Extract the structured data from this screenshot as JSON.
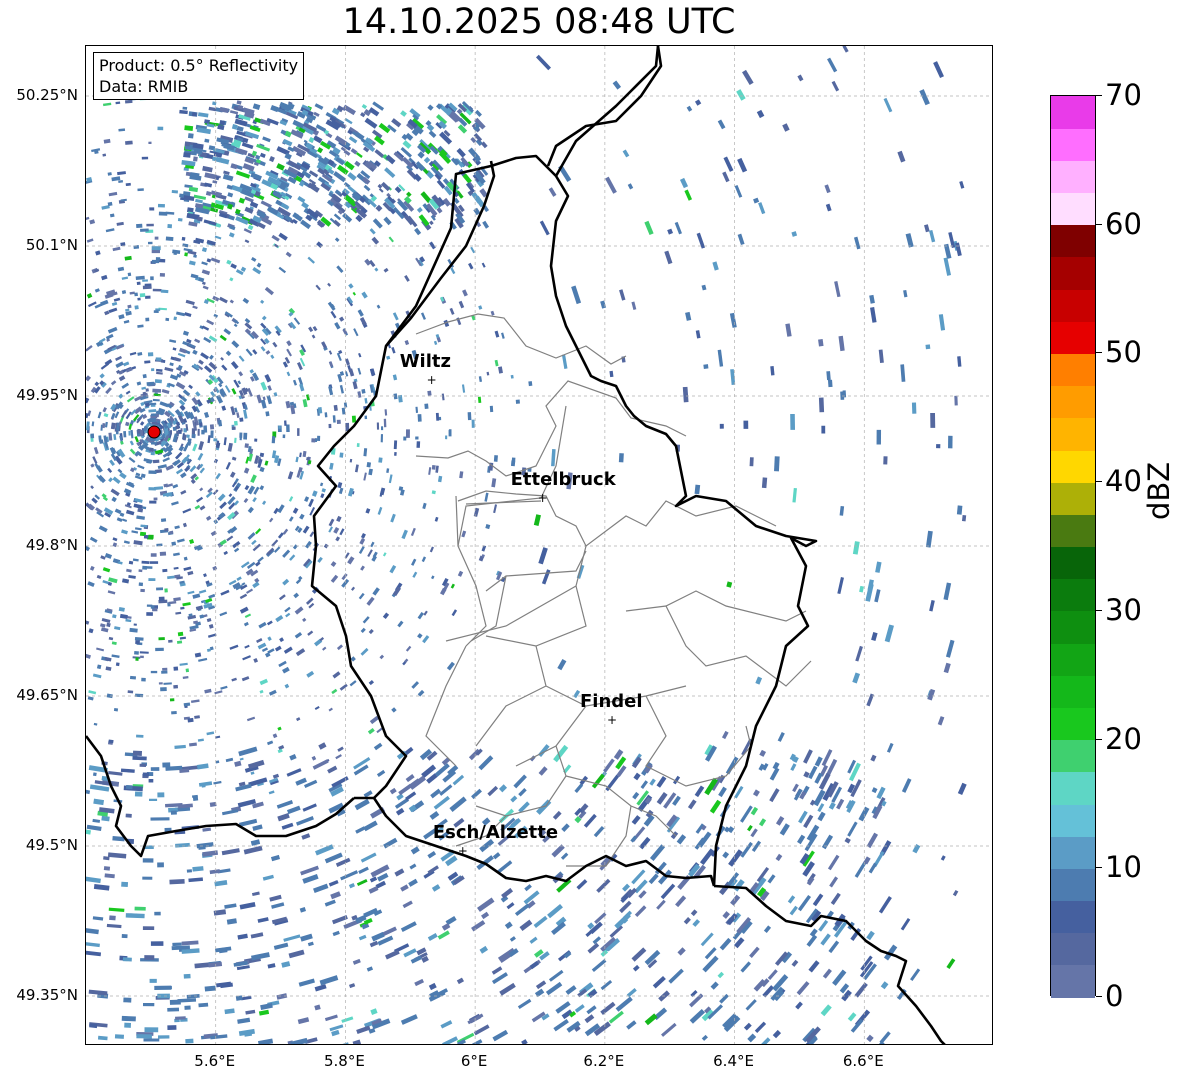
{
  "title": "14.10.2025 08:48 UTC",
  "info": {
    "product": "Product: 0.5° Reflectivity",
    "data": "Data: RMIB"
  },
  "map": {
    "extent": {
      "lon_min": 5.4,
      "lon_max": 6.8,
      "lat_min": 49.3,
      "lat_max": 50.3
    },
    "lat_ticks": [
      {
        "value": 50.25,
        "label": "50.25°N"
      },
      {
        "value": 50.1,
        "label": "50.1°N"
      },
      {
        "value": 49.95,
        "label": "49.95°N"
      },
      {
        "value": 49.8,
        "label": "49.8°N"
      },
      {
        "value": 49.65,
        "label": "49.65°N"
      },
      {
        "value": 49.5,
        "label": "49.5°N"
      },
      {
        "value": 49.35,
        "label": "49.35°N"
      }
    ],
    "lon_ticks": [
      {
        "value": 5.6,
        "label": "5.6°E"
      },
      {
        "value": 5.8,
        "label": "5.8°E"
      },
      {
        "value": 6.0,
        "label": "6°E"
      },
      {
        "value": 6.2,
        "label": "6.2°E"
      },
      {
        "value": 6.4,
        "label": "6.4°E"
      },
      {
        "value": 6.6,
        "label": "6.6°E"
      }
    ],
    "gridlines": true,
    "radar_site": {
      "lon": 5.505,
      "lat": 49.914
    },
    "cities": [
      {
        "name": "Wiltz",
        "lon": 5.933,
        "lat": 49.967
      },
      {
        "name": "Ettelbruck",
        "lon": 6.104,
        "lat": 49.849
      },
      {
        "name": "Findel",
        "lon": 6.211,
        "lat": 49.627
      },
      {
        "name": "Esch/Alzette",
        "lon": 5.981,
        "lat": 49.496
      }
    ],
    "colors": {
      "border": "#000000",
      "canton": "#808080",
      "grid": "#b0b0b0",
      "radar_marker": "#e60000"
    }
  },
  "colorbar": {
    "label": "dBZ",
    "min": 0,
    "max": 70,
    "tick_labels": [
      {
        "value": 70,
        "label": "70"
      },
      {
        "value": 60,
        "label": "60"
      },
      {
        "value": 50,
        "label": "50"
      },
      {
        "value": 40,
        "label": "40"
      },
      {
        "value": 30,
        "label": "30"
      },
      {
        "value": 20,
        "label": "20"
      },
      {
        "value": 10,
        "label": "10"
      },
      {
        "value": 0,
        "label": "0"
      }
    ],
    "colors": [
      "#6575a8",
      "#55689f",
      "#45609f",
      "#4d7cb0",
      "#5b9cc6",
      "#64c1d8",
      "#5ed6c5",
      "#3fd06f",
      "#19c81e",
      "#14b81a",
      "#12a515",
      "#0e8f10",
      "#0b7c0d",
      "#086509",
      "#4a7a11",
      "#adb007",
      "#ffd700",
      "#ffb400",
      "#ff9c00",
      "#ff7f00",
      "#e60000",
      "#c80000",
      "#a50000",
      "#7f0000",
      "#ffddff",
      "#ffb0ff",
      "#ff6eff",
      "#e93be9"
    ]
  }
}
